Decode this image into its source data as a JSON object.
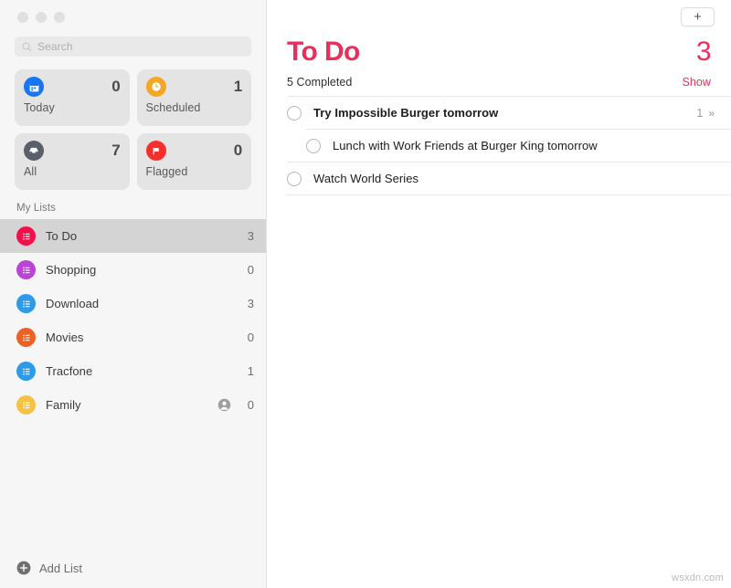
{
  "window": {
    "traffic_lights": [
      "close",
      "minimize",
      "zoom"
    ]
  },
  "sidebar": {
    "search": {
      "placeholder": "Search",
      "icon": "search-icon"
    },
    "smart_lists": [
      {
        "label": "Today",
        "count": "0",
        "icon": "calendar-icon",
        "color": "#1676f3"
      },
      {
        "label": "Scheduled",
        "count": "1",
        "icon": "clock-icon",
        "color": "#f5a623"
      },
      {
        "label": "All",
        "count": "7",
        "icon": "inbox-icon",
        "color": "#59606b"
      },
      {
        "label": "Flagged",
        "count": "0",
        "icon": "flag-icon",
        "color": "#f5302c"
      }
    ],
    "section_header": "My Lists",
    "lists": [
      {
        "label": "To Do",
        "count": "3",
        "color": "#f0104a",
        "selected": true,
        "shared": false
      },
      {
        "label": "Shopping",
        "count": "0",
        "color": "#bb44d6",
        "selected": false,
        "shared": false
      },
      {
        "label": "Download",
        "count": "3",
        "color": "#2f9ae8",
        "selected": false,
        "shared": false
      },
      {
        "label": "Movies",
        "count": "0",
        "color": "#ef6123",
        "selected": false,
        "shared": false
      },
      {
        "label": "Tracfone",
        "count": "1",
        "color": "#2f9ae8",
        "selected": false,
        "shared": false
      },
      {
        "label": "Family",
        "count": "0",
        "color": "#f7c244",
        "selected": false,
        "shared": true
      }
    ],
    "add_list": {
      "label": "Add List",
      "icon": "plus-circle-icon"
    }
  },
  "main": {
    "toolbar": {
      "add_button": "+"
    },
    "title": "To Do",
    "total_count": "3",
    "completed_label": "5 Completed",
    "show_link": "Show",
    "accent_color": "#e8305c",
    "tasks": [
      {
        "text": "Try Impossible Burger tomorrow",
        "bold": true,
        "sub": false,
        "subtask_count": "1",
        "chevron": "»"
      },
      {
        "text": "Lunch with Work Friends at Burger King tomorrow",
        "bold": false,
        "sub": true,
        "subtask_count": "",
        "chevron": ""
      },
      {
        "text": "Watch World Series",
        "bold": false,
        "sub": false,
        "subtask_count": "",
        "chevron": ""
      }
    ]
  },
  "watermark": "wsxdn.com"
}
